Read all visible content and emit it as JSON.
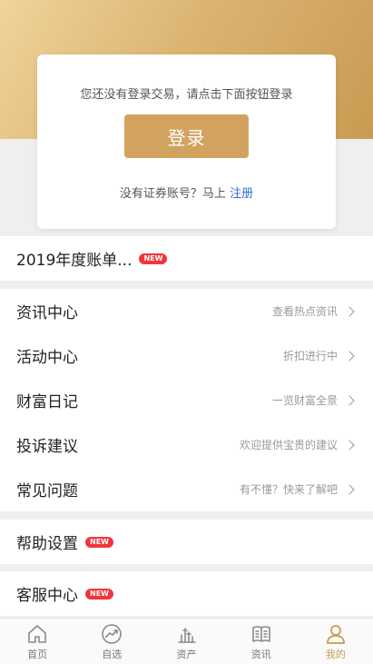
{
  "login": {
    "hint": "您还没有登录交易，请点击下面按钮登录",
    "button_label": "登录",
    "register_prompt": "没有证券账号？马上",
    "register_link": "注册"
  },
  "bill": {
    "title": "2019年度账单...",
    "badge": "NEW"
  },
  "menu": [
    {
      "title": "资讯中心",
      "sub": "查看热点资讯"
    },
    {
      "title": "活动中心",
      "sub": "折扣进行中"
    },
    {
      "title": "财富日记",
      "sub": "一览财富全景"
    },
    {
      "title": "投诉建议",
      "sub": "欢迎提供宝贵的建议"
    },
    {
      "title": "常见问题",
      "sub": "有不懂？快来了解吧"
    }
  ],
  "help": {
    "title": "帮助设置",
    "badge": "NEW"
  },
  "service": {
    "title": "客服中心",
    "badge": "NEW"
  },
  "tabs": [
    {
      "label": "首页",
      "icon": "home-icon"
    },
    {
      "label": "自选",
      "icon": "trend-icon"
    },
    {
      "label": "资产",
      "icon": "assets-icon"
    },
    {
      "label": "资讯",
      "icon": "news-icon"
    },
    {
      "label": "我的",
      "icon": "user-icon",
      "active": true
    }
  ],
  "colors": {
    "accent": "#d2a35f",
    "badge": "#f0353c",
    "link": "#2f6fd6"
  }
}
